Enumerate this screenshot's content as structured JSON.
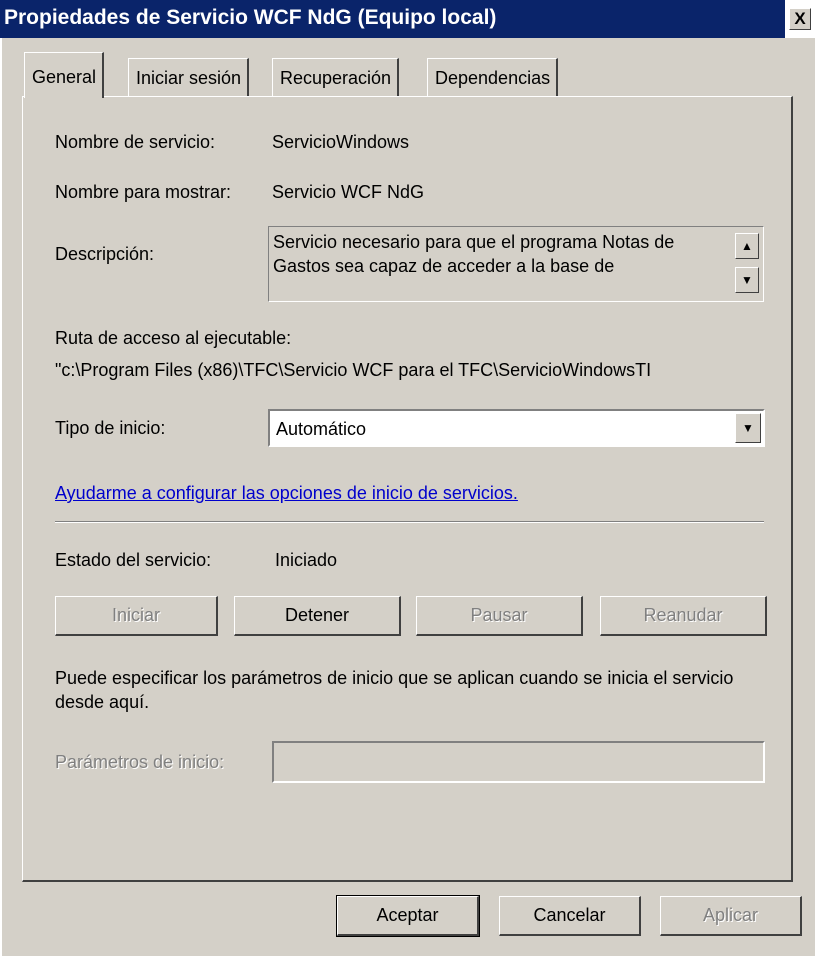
{
  "window": {
    "title": "Propiedades de Servicio WCF NdG (Equipo local)",
    "close_label": "X"
  },
  "tabs": [
    {
      "label": "General",
      "active": true
    },
    {
      "label": "Iniciar sesión",
      "active": false
    },
    {
      "label": "Recuperación",
      "active": false
    },
    {
      "label": "Dependencias",
      "active": false
    }
  ],
  "general": {
    "service_name_label": "Nombre de servicio:",
    "service_name_value": "ServicioWindows",
    "display_name_label": "Nombre para mostrar:",
    "display_name_value": "Servicio WCF NdG",
    "description_label": "Descripción:",
    "description_value": "Servicio necesario para que el programa Notas de Gastos sea capaz de acceder a la base de",
    "exe_path_label": "Ruta de acceso al ejecutable:",
    "exe_path_value": "\"c:\\Program Files (x86)\\TFC\\Servicio WCF para el TFC\\ServicioWindowsTI",
    "startup_type_label": "Tipo de inicio:",
    "startup_type_value": "Automático",
    "help_link": "Ayudarme a configurar las opciones de inicio de servicios.",
    "status_label": "Estado del servicio:",
    "status_value": "Iniciado",
    "buttons": {
      "start": "Iniciar",
      "stop": "Detener",
      "pause": "Pausar",
      "resume": "Reanudar"
    },
    "params_note": "Puede especificar los parámetros de inicio que se aplican cuando se inicia el servicio desde aquí.",
    "params_label": "Parámetros de inicio:",
    "params_value": ""
  },
  "footer": {
    "ok": "Aceptar",
    "cancel": "Cancelar",
    "apply": "Aplicar"
  },
  "colors": {
    "titlebar": "#0a246a",
    "face": "#d4d0c8",
    "link": "#0000cc"
  },
  "icons": [
    "close-icon",
    "scroll-up-icon",
    "scroll-down-icon",
    "dropdown-arrow-icon"
  ]
}
